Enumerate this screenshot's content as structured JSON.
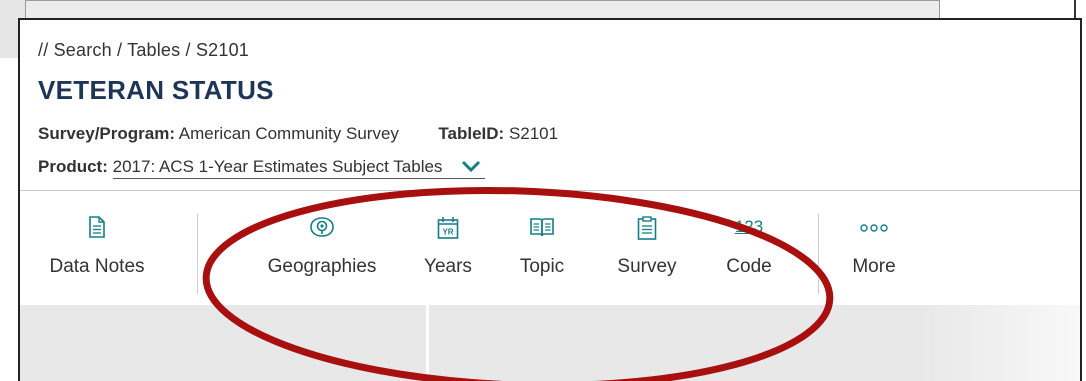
{
  "breadcrumb": "// Search / Tables / S2101",
  "title": "VETERAN STATUS",
  "meta": {
    "survey_label": "Survey/Program:",
    "survey_value": "American Community Survey",
    "tableid_label": "TableID:",
    "tableid_value": "S2101",
    "product_label": "Product:",
    "product_value": "2017: ACS 1-Year Estimates Subject Tables"
  },
  "toolbar": {
    "data_notes": "Data Notes",
    "geographies": "Geographies",
    "years": "Years",
    "years_icon_text": "YR",
    "topic": "Topic",
    "survey": "Survey",
    "code": "Code",
    "code_icon_text": "123",
    "more": "More"
  },
  "colors": {
    "accent": "#147f86",
    "title": "#1d3658",
    "annotation": "#a81010"
  },
  "icons": [
    "document-icon",
    "location-icon",
    "calendar-icon",
    "book-icon",
    "clipboard-icon",
    "code-icon",
    "more-icon",
    "chevron-down-icon"
  ]
}
